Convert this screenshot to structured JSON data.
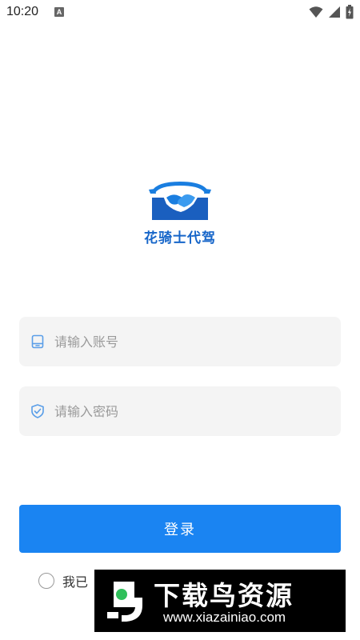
{
  "status_bar": {
    "time": "10:20",
    "notification_letter": "A",
    "icons": [
      "wifi-icon",
      "signal-icon",
      "battery-icon"
    ]
  },
  "brand": {
    "name": "花骑士代驾",
    "colors": {
      "primary": "#1766c9",
      "accent": "#1a84f2"
    }
  },
  "form": {
    "account": {
      "placeholder": "请输入账号",
      "value": "",
      "icon": "phone-icon"
    },
    "password": {
      "placeholder": "请输入密码",
      "value": "",
      "icon": "shield-check-icon"
    },
    "login_label": "登录",
    "agreement_text": "我已"
  },
  "watermark": {
    "title": "下载鸟资源",
    "url": "www.xiazainiao.com"
  }
}
